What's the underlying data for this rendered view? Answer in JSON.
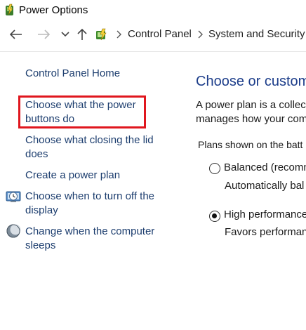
{
  "window": {
    "title": "Power Options",
    "icon": "power-options-icon"
  },
  "address_bar": {
    "back_icon": "arrow-left-icon",
    "forward_icon": "arrow-right-icon",
    "recent_icon": "chevron-down-icon",
    "up_icon": "arrow-up-icon",
    "location_icon": "control-panel-icon",
    "breadcrumbs": [
      "Control Panel",
      "System and Security"
    ]
  },
  "sidebar": {
    "home_link": "Control Panel Home",
    "links": [
      {
        "line1": "Choose what the power",
        "line2": "buttons do",
        "highlighted": true
      },
      {
        "line1": "Choose what closing the lid",
        "line2": "does"
      },
      {
        "line1": "Create a power plan"
      },
      {
        "line1": "Choose when to turn off the",
        "line2": "display",
        "icon": "display-clock-icon"
      },
      {
        "line1": "Change when the computer",
        "line2": "sleeps",
        "icon": "moon-sleep-icon"
      }
    ],
    "highlight_color": "#e0161e"
  },
  "main": {
    "heading": "Choose or custom",
    "description_line1": "A power plan is a collec",
    "description_line2": "manages how your com",
    "plans_label": "Plans shown on the batt",
    "plans": [
      {
        "name": "Balanced (recomme",
        "description": "Automatically bal",
        "selected": false
      },
      {
        "name": "High performance",
        "description": "Favors performanc",
        "selected": true
      }
    ]
  },
  "colors": {
    "link": "#1c3d6e",
    "heading": "#1c3d8a"
  }
}
